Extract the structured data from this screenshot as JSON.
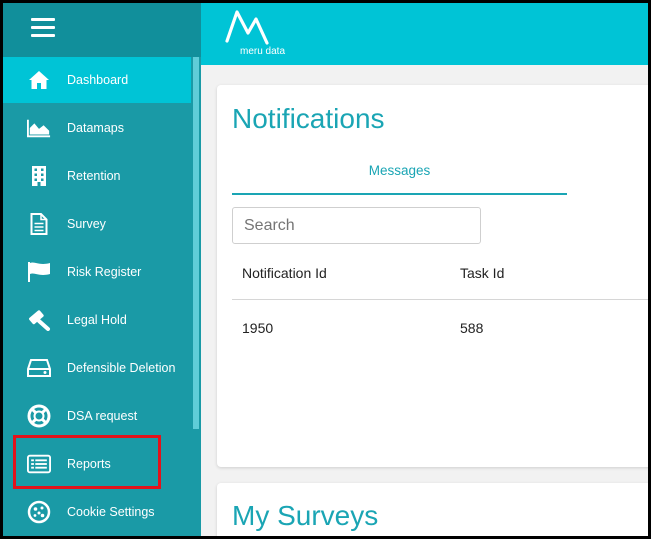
{
  "app": {
    "logo_text": "meru data"
  },
  "sidebar": {
    "items": [
      {
        "label": "Dashboard",
        "icon": "home-icon",
        "active": true
      },
      {
        "label": "Datamaps",
        "icon": "area-chart-icon",
        "active": false
      },
      {
        "label": "Retention",
        "icon": "building-icon",
        "active": false
      },
      {
        "label": "Survey",
        "icon": "document-icon",
        "active": false
      },
      {
        "label": "Risk Register",
        "icon": "flag-icon",
        "active": false
      },
      {
        "label": "Legal Hold",
        "icon": "gavel-icon",
        "active": false
      },
      {
        "label": "Defensible Deletion",
        "icon": "hard-drive-icon",
        "active": false
      },
      {
        "label": "DSA request",
        "icon": "life-ring-icon",
        "active": false
      },
      {
        "label": "Reports",
        "icon": "list-alt-icon",
        "active": false
      },
      {
        "label": "Cookie Settings",
        "icon": "cookie-icon",
        "active": false
      }
    ]
  },
  "notifications": {
    "title": "Notifications",
    "tab_label": "Messages",
    "search_placeholder": "Search",
    "columns": [
      "Notification Id",
      "Task Id"
    ],
    "rows": [
      [
        "1950",
        "588"
      ]
    ]
  },
  "surveys": {
    "title": "My Surveys"
  },
  "colors": {
    "sidebar_bg": "#1a9aa6",
    "accent": "#00c4d6",
    "title_text": "#1aa5b4",
    "highlight": "#e3121b"
  }
}
